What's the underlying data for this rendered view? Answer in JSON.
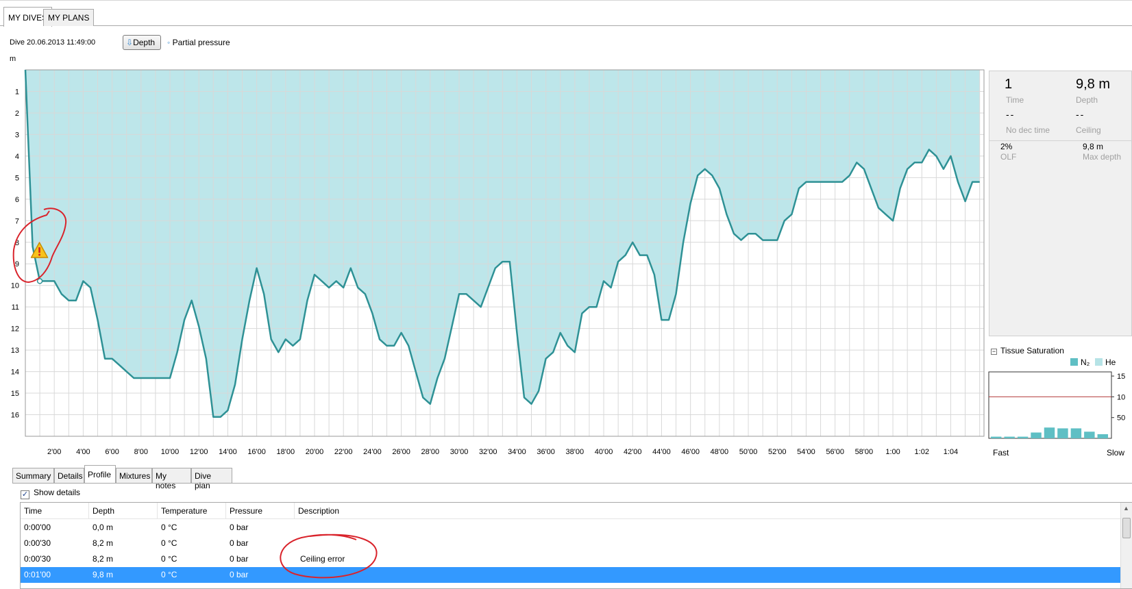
{
  "tabs": [
    {
      "label": "MY DIVES",
      "active": true
    },
    {
      "label": "MY PLANS",
      "active": false
    }
  ],
  "dive_title": "Dive 20.06.2013 11:49:00",
  "view_buttons": {
    "depth": "Depth",
    "partial_pressure": "Partial pressure"
  },
  "chart_data": {
    "type": "area",
    "ylabel": "m",
    "y_inverted": true,
    "ylim": [
      0,
      17
    ],
    "yticks": [
      "1",
      "2",
      "3",
      "4",
      "5",
      "6",
      "7",
      "8",
      "9",
      "10",
      "11",
      "12",
      "13",
      "14",
      "15",
      "16"
    ],
    "xlim_minutes": [
      0,
      66.3
    ],
    "xticks": [
      {
        "t": 2,
        "label": "2'00"
      },
      {
        "t": 4,
        "label": "4'00"
      },
      {
        "t": 6,
        "label": "6'00"
      },
      {
        "t": 8,
        "label": "8'00"
      },
      {
        "t": 10,
        "label": "10'00"
      },
      {
        "t": 12,
        "label": "12'00"
      },
      {
        "t": 14,
        "label": "14'00"
      },
      {
        "t": 16,
        "label": "16'00"
      },
      {
        "t": 18,
        "label": "18'00"
      },
      {
        "t": 20,
        "label": "20'00"
      },
      {
        "t": 22,
        "label": "22'00"
      },
      {
        "t": 24,
        "label": "24'00"
      },
      {
        "t": 26,
        "label": "26'00"
      },
      {
        "t": 28,
        "label": "28'00"
      },
      {
        "t": 30,
        "label": "30'00"
      },
      {
        "t": 32,
        "label": "32'00"
      },
      {
        "t": 34,
        "label": "34'00"
      },
      {
        "t": 36,
        "label": "36'00"
      },
      {
        "t": 38,
        "label": "38'00"
      },
      {
        "t": 40,
        "label": "40'00"
      },
      {
        "t": 42,
        "label": "42'00"
      },
      {
        "t": 44,
        "label": "44'00"
      },
      {
        "t": 46,
        "label": "46'00"
      },
      {
        "t": 48,
        "label": "48'00"
      },
      {
        "t": 50,
        "label": "50'00"
      },
      {
        "t": 52,
        "label": "52'00"
      },
      {
        "t": 54,
        "label": "54'00"
      },
      {
        "t": 56,
        "label": "56'00"
      },
      {
        "t": 58,
        "label": "58'00"
      },
      {
        "t": 60,
        "label": "1:00"
      },
      {
        "t": 62,
        "label": "1:02"
      },
      {
        "t": 64,
        "label": "1:04"
      }
    ],
    "series": [
      {
        "points": [
          [
            0,
            0
          ],
          [
            0.5,
            8.2
          ],
          [
            1,
            9.8
          ],
          [
            2,
            9.8
          ],
          [
            2.5,
            10.4
          ],
          [
            3,
            10.7
          ],
          [
            3.5,
            10.7
          ],
          [
            4,
            9.8
          ],
          [
            4.5,
            10.1
          ],
          [
            5,
            11.6
          ],
          [
            5.5,
            13.4
          ],
          [
            6,
            13.4
          ],
          [
            6.5,
            13.7
          ],
          [
            7,
            14
          ],
          [
            7.5,
            14.3
          ],
          [
            8,
            14.3
          ],
          [
            9,
            14.3
          ],
          [
            10,
            14.3
          ],
          [
            10.5,
            13.1
          ],
          [
            11,
            11.6
          ],
          [
            11.5,
            10.7
          ],
          [
            12,
            11.9
          ],
          [
            12.5,
            13.4
          ],
          [
            13,
            16.1
          ],
          [
            13.5,
            16.1
          ],
          [
            14,
            15.8
          ],
          [
            14.5,
            14.6
          ],
          [
            15,
            12.5
          ],
          [
            15.5,
            10.7
          ],
          [
            16,
            9.2
          ],
          [
            16.5,
            10.4
          ],
          [
            17,
            12.5
          ],
          [
            17.5,
            13.1
          ],
          [
            18,
            12.5
          ],
          [
            18.5,
            12.8
          ],
          [
            19,
            12.5
          ],
          [
            19.5,
            10.7
          ],
          [
            20,
            9.5
          ],
          [
            20.5,
            9.8
          ],
          [
            21,
            10.1
          ],
          [
            21.5,
            9.8
          ],
          [
            22,
            10.1
          ],
          [
            22.5,
            9.2
          ],
          [
            23,
            10.1
          ],
          [
            23.5,
            10.4
          ],
          [
            24,
            11.3
          ],
          [
            24.5,
            12.5
          ],
          [
            25,
            12.8
          ],
          [
            25.5,
            12.8
          ],
          [
            26,
            12.2
          ],
          [
            26.5,
            12.8
          ],
          [
            27,
            14
          ],
          [
            27.5,
            15.2
          ],
          [
            28,
            15.5
          ],
          [
            28.5,
            14.3
          ],
          [
            29,
            13.4
          ],
          [
            29.5,
            11.9
          ],
          [
            30,
            10.4
          ],
          [
            30.5,
            10.4
          ],
          [
            31,
            10.7
          ],
          [
            31.5,
            11
          ],
          [
            32,
            10.1
          ],
          [
            32.5,
            9.2
          ],
          [
            33,
            8.9
          ],
          [
            33.5,
            8.9
          ],
          [
            34,
            12.2
          ],
          [
            34.5,
            15.2
          ],
          [
            35,
            15.5
          ],
          [
            35.5,
            14.9
          ],
          [
            36,
            13.4
          ],
          [
            36.5,
            13.1
          ],
          [
            37,
            12.2
          ],
          [
            37.5,
            12.8
          ],
          [
            38,
            13.1
          ],
          [
            38.5,
            11.3
          ],
          [
            39,
            11
          ],
          [
            39.5,
            11
          ],
          [
            40,
            9.8
          ],
          [
            40.5,
            10.1
          ],
          [
            41,
            8.9
          ],
          [
            41.5,
            8.6
          ],
          [
            42,
            8
          ],
          [
            42.5,
            8.6
          ],
          [
            43,
            8.6
          ],
          [
            43.5,
            9.5
          ],
          [
            44,
            11.6
          ],
          [
            44.5,
            11.6
          ],
          [
            45,
            10.4
          ],
          [
            45.5,
            8
          ],
          [
            46,
            6.2
          ],
          [
            46.5,
            4.9
          ],
          [
            47,
            4.6
          ],
          [
            47.5,
            4.9
          ],
          [
            48,
            5.5
          ],
          [
            48.5,
            6.7
          ],
          [
            49,
            7.6
          ],
          [
            49.5,
            7.9
          ],
          [
            50,
            7.6
          ],
          [
            50.5,
            7.6
          ],
          [
            51,
            7.9
          ],
          [
            51.5,
            7.9
          ],
          [
            52,
            7.9
          ],
          [
            52.5,
            7
          ],
          [
            53,
            6.7
          ],
          [
            53.5,
            5.5
          ],
          [
            54,
            5.2
          ],
          [
            54.5,
            5.2
          ],
          [
            55,
            5.2
          ],
          [
            56,
            5.2
          ],
          [
            56.5,
            5.2
          ],
          [
            57,
            4.9
          ],
          [
            57.5,
            4.3
          ],
          [
            58,
            4.6
          ],
          [
            58.5,
            5.5
          ],
          [
            59,
            6.4
          ],
          [
            59.5,
            6.7
          ],
          [
            60,
            7
          ],
          [
            60.5,
            5.5
          ],
          [
            61,
            4.6
          ],
          [
            61.5,
            4.3
          ],
          [
            62,
            4.3
          ],
          [
            62.5,
            3.7
          ],
          [
            63,
            4
          ],
          [
            63.5,
            4.6
          ],
          [
            64,
            4
          ],
          [
            64.5,
            5.2
          ],
          [
            65,
            6.1
          ],
          [
            65.5,
            5.2
          ],
          [
            66,
            5.2
          ]
        ]
      }
    ],
    "warning_marker": {
      "t": 0.5,
      "depth": 8.2
    },
    "current_marker": {
      "t": 1,
      "depth": 9.8
    },
    "grid": true,
    "colors": {
      "fill": "#bde6ea",
      "line": "#2e9195"
    }
  },
  "info_panel": {
    "time_value": "1",
    "time_label": "Time",
    "depth_value": "9,8 m",
    "depth_label": "Depth",
    "nodec_value": "--",
    "nodec_label": "No dec time",
    "ceiling_value": "--",
    "ceiling_label": "Ceiling",
    "olf_value": "2%",
    "olf_label": "OLF",
    "maxdepth_value": "9,8 m",
    "maxdepth_label": "Max depth"
  },
  "tissue": {
    "title": "Tissue Saturation",
    "legend": [
      "N₂",
      "He"
    ],
    "yticks": [
      "15",
      "10",
      "50"
    ],
    "fast_label": "Fast",
    "slow_label": "Slow",
    "compartments": [
      2,
      2,
      2,
      7,
      13,
      12,
      12,
      8,
      5
    ],
    "limit": 100,
    "colors": {
      "n2": "#5fbfc4",
      "he": "#b6e3e6",
      "limit": "#b33a3a"
    }
  },
  "bottom_tabs": [
    "Summary",
    "Details",
    "Profile",
    "Mixtures",
    "My notes",
    "Dive plan"
  ],
  "active_bottom_tab": "Profile",
  "show_details_label": "Show details",
  "table": {
    "columns": [
      "Time",
      "Depth",
      "Temperature",
      "Pressure",
      "Description"
    ],
    "rows": [
      [
        "0:00'00",
        "0,0 m",
        "0 °C",
        "0 bar",
        ""
      ],
      [
        "0:00'30",
        "8,2 m",
        "0 °C",
        "0 bar",
        ""
      ],
      [
        "0:00'30",
        "8,2 m",
        "0 °C",
        "0 bar",
        "Ceiling error"
      ],
      [
        "0:01'00",
        "9,8 m",
        "0 °C",
        "0 bar",
        ""
      ]
    ],
    "selected_row": 3
  }
}
